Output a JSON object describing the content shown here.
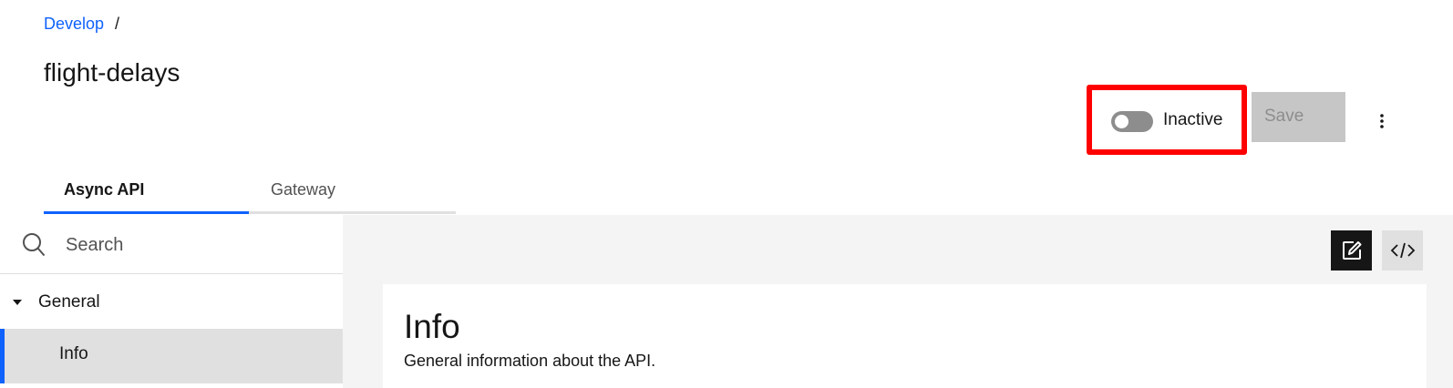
{
  "breadcrumb": {
    "link": "Develop",
    "separator": "/"
  },
  "page": {
    "title": "flight-delays"
  },
  "toolbar": {
    "toggle_label": "Inactive",
    "toggle_state": "off",
    "save_label": "Save",
    "save_enabled": false
  },
  "tabs": [
    {
      "label": "Async API",
      "active": true
    },
    {
      "label": "Gateway",
      "active": false
    }
  ],
  "sidebar": {
    "search_placeholder": "Search",
    "groups": [
      {
        "label": "General",
        "expanded": true,
        "items": [
          {
            "label": "Info",
            "selected": true
          }
        ]
      }
    ]
  },
  "main": {
    "icons": [
      "edit-icon",
      "code-icon"
    ],
    "card": {
      "title": "Info",
      "description": "General information about the API."
    }
  },
  "colors": {
    "accent": "#0f62fe",
    "highlight": "#ff0000",
    "disabled_button": "#c6c6c6",
    "toggle_off": "#8d8d8d"
  }
}
